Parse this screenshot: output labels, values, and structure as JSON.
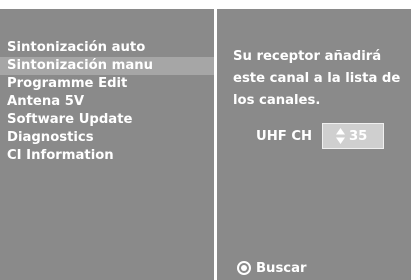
{
  "menu": {
    "items": [
      {
        "label": "Sintonización auto",
        "selected": false
      },
      {
        "label": "Sintonización manu",
        "selected": true
      },
      {
        "label": "Programme Edit",
        "selected": false
      },
      {
        "label": "Antena 5V",
        "selected": false
      },
      {
        "label": "Software Update",
        "selected": false
      },
      {
        "label": "Diagnostics",
        "selected": false
      },
      {
        "label": "CI Information",
        "selected": false
      }
    ]
  },
  "detail": {
    "message": "Su receptor añadirá este canal a la lista de los canales.",
    "channel_label": "UHF CH",
    "channel_value": "35",
    "channel_icon": "up-down-arrows-icon",
    "search_label": "Buscar",
    "search_icon": "radio-selected-icon"
  },
  "colors": {
    "panel": "#8a8a8a",
    "selected_row": "#a6a6a6",
    "input_box": "#cfcfcf",
    "text": "#ffffff"
  }
}
